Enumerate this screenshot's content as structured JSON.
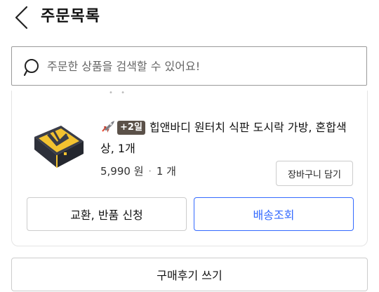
{
  "header": {
    "title": "주문목록",
    "back_icon": "chevron-left-icon"
  },
  "search": {
    "placeholder": "주문한 상품을 검색할 수 있어요!",
    "value": "",
    "icon": "search-icon"
  },
  "order": {
    "product": {
      "badge": "+2일",
      "name": "힙앤바디 원터치 식판 도시락 가방, 혼합색상, 1개",
      "price": "5,990 원",
      "separator": "·",
      "quantity": "1 개",
      "rocket_icon": "rocket-icon",
      "thumbnail": "lunchbox-bag-image"
    },
    "cart_button_label": "장바구니 담기",
    "exchange_button_label": "교환, 반품 신청",
    "tracking_button_label": "배송조회"
  },
  "review_button_label": "구매후기 쓰기",
  "colors": {
    "accent_blue": "#346aff",
    "border_gray": "#cccccc",
    "badge_bg": "#5b5149"
  }
}
